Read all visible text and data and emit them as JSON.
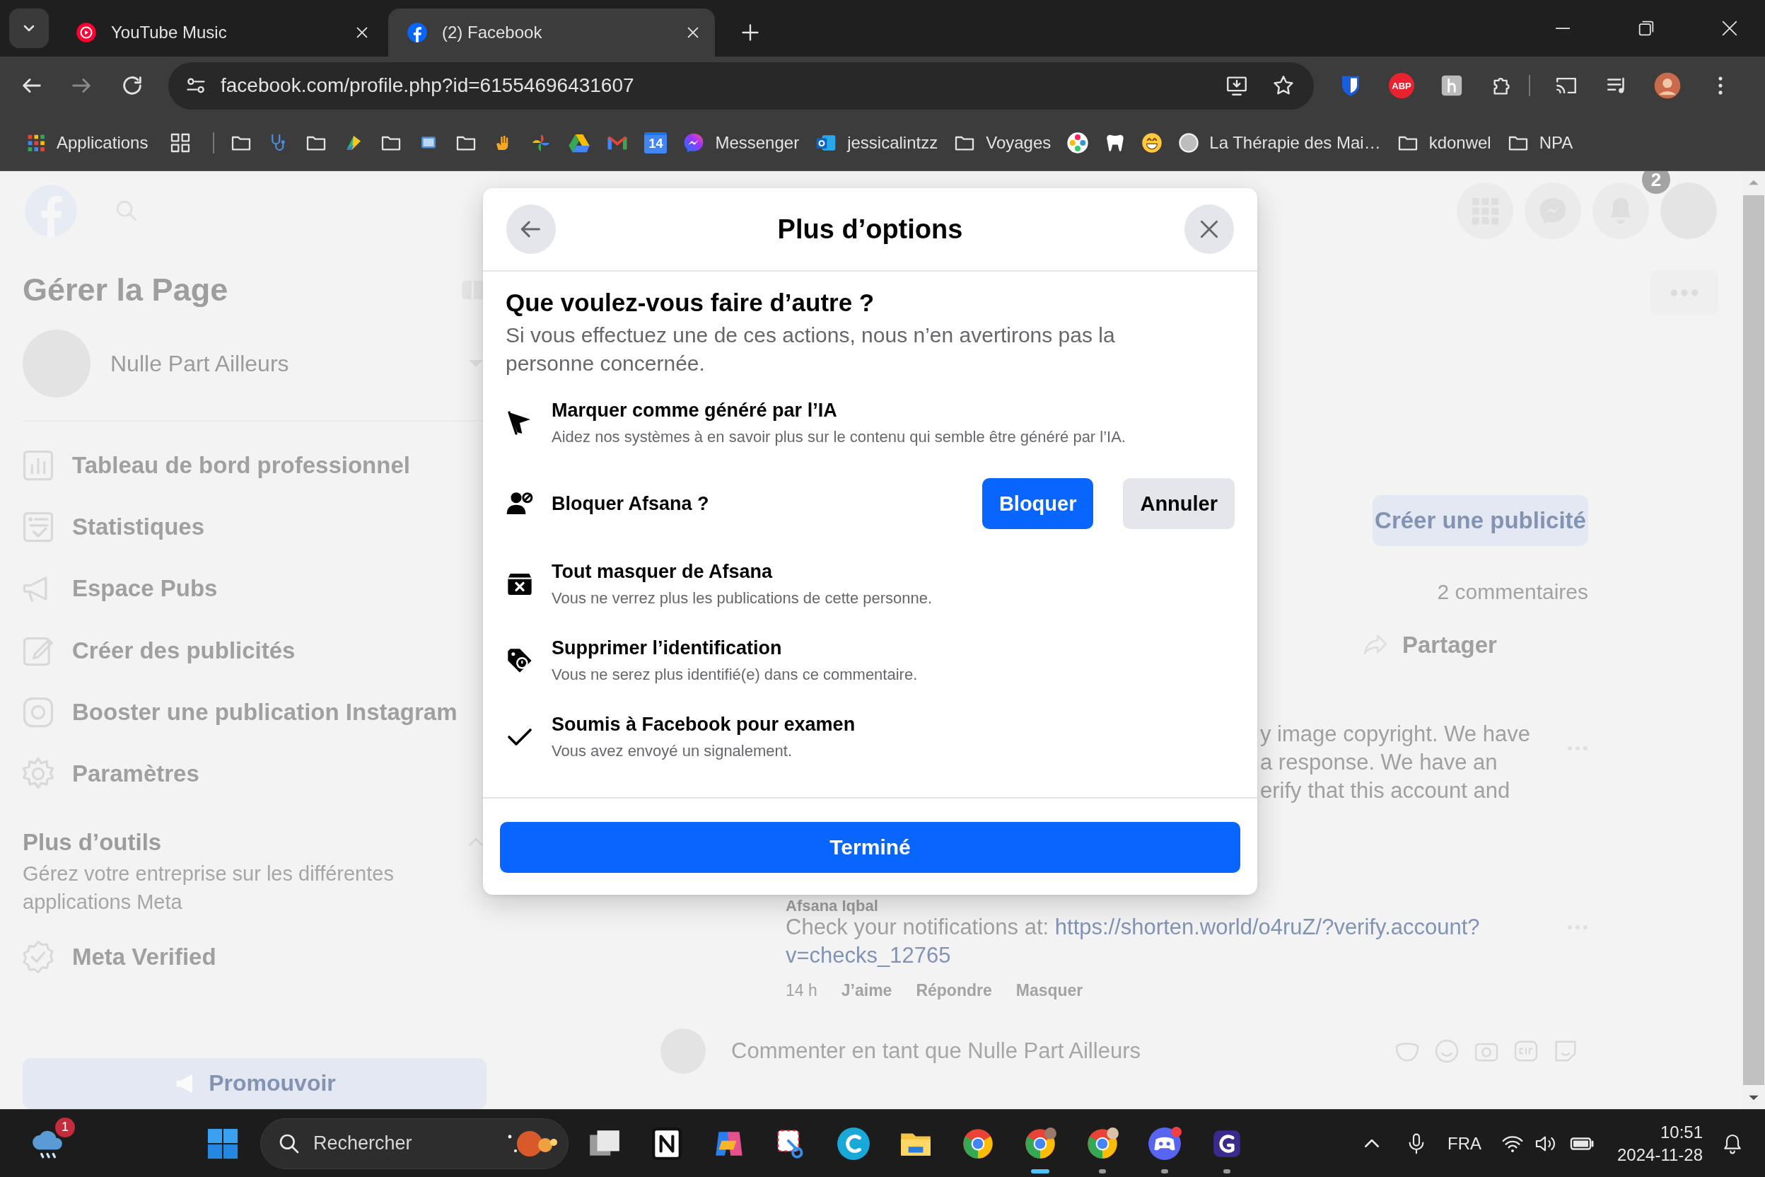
{
  "browser": {
    "tabs": [
      {
        "title": "YouTube Music",
        "selected": false
      },
      {
        "title": "(2) Facebook",
        "selected": true
      }
    ],
    "url": "facebook.com/profile.php?id=61554696431607",
    "extension_badge": "ABP",
    "bookmarks": [
      {
        "kind": "apps",
        "label": "Applications"
      },
      {
        "kind": "tab-groups"
      },
      {
        "kind": "separator"
      },
      {
        "kind": "folder"
      },
      {
        "kind": "site"
      },
      {
        "kind": "folder"
      },
      {
        "kind": "site"
      },
      {
        "kind": "folder"
      },
      {
        "kind": "site"
      },
      {
        "kind": "folder"
      },
      {
        "kind": "site"
      },
      {
        "kind": "site"
      },
      {
        "kind": "site"
      },
      {
        "kind": "site"
      },
      {
        "kind": "calendar",
        "label": "14"
      },
      {
        "kind": "site",
        "label": "Messenger"
      },
      {
        "kind": "site",
        "label": "jessicalintzz"
      },
      {
        "kind": "folder",
        "label": "Voyages"
      },
      {
        "kind": "site"
      },
      {
        "kind": "site"
      },
      {
        "kind": "site"
      },
      {
        "kind": "site",
        "label": "La Thérapie des Mai…"
      },
      {
        "kind": "folder",
        "label": "kdonwel"
      },
      {
        "kind": "folder",
        "label": "NPA"
      }
    ]
  },
  "page": {
    "sidebar": {
      "title": "Gérer la Page",
      "page_name": "Nulle Part Ailleurs",
      "menu": [
        "Tableau de bord professionnel",
        "Statistiques",
        "Espace Pubs",
        "Créer des publicités",
        "Booster une publication Instagram",
        "Paramètres"
      ],
      "more_tools": {
        "title": "Plus d’outils",
        "description": "Gérez votre entreprise sur les différentes applications Meta"
      },
      "meta_verified": "Meta Verified",
      "promote_button": "Promouvoir"
    },
    "notification_badge": "2",
    "feed": {
      "ad_button": "Créer une publicité",
      "comment_count": "2 commentaires",
      "share": "Partager",
      "comment_fragment": [
        "y image copyright. We have",
        "a response. We have an",
        "erify that this account and"
      ],
      "comment": {
        "author": "Afsana Iqbal",
        "text": "Check your notifications at:",
        "link_lines": [
          "https://shorten.world/o4ruZ/?verify.account?",
          "v=checks_12765"
        ],
        "time": "14 h",
        "actions": [
          "J’aime",
          "Répondre",
          "Masquer"
        ]
      },
      "composer": {
        "placeholder": "Commenter en tant que Nulle Part Ailleurs"
      }
    }
  },
  "dialog": {
    "title": "Plus d’options",
    "heading": "Que voulez-vous faire d’autre ?",
    "subtitle": "Si vous effectuez une de ces actions, nous n’en avertirons pas la personne concernée.",
    "options": [
      {
        "kind": "action",
        "title": "Marquer comme généré par l’IA",
        "description": "Aidez nos systèmes à en savoir plus sur le contenu qui semble être généré par l’IA."
      },
      {
        "kind": "confirm",
        "title": "Bloquer Afsana ?",
        "buttons": [
          {
            "label": "Bloquer",
            "primary": true
          },
          {
            "label": "Annuler",
            "primary": false
          }
        ]
      },
      {
        "kind": "action",
        "title": "Tout masquer de Afsana",
        "description": "Vous ne verrez plus les publications de cette personne."
      },
      {
        "kind": "action",
        "title": "Supprimer l’identification",
        "description": "Vous ne serez plus identifié(e) dans ce commentaire."
      },
      {
        "kind": "action",
        "title": "Soumis à Facebook pour examen",
        "description": "Vous avez envoyé un signalement."
      }
    ],
    "done_button": "Terminé"
  },
  "taskbar": {
    "weather_badge": "1",
    "search": {
      "placeholder": "Rechercher"
    },
    "apps": [
      {
        "open": false,
        "selected": false
      },
      {
        "open": false,
        "selected": false
      },
      {
        "open": false,
        "selected": false
      },
      {
        "open": false,
        "selected": false
      },
      {
        "open": false,
        "selected": false
      },
      {
        "open": false,
        "selected": false
      },
      {
        "open": false,
        "selected": false
      },
      {
        "open": true,
        "selected": true
      },
      {
        "open": true,
        "selected": false
      },
      {
        "open": true,
        "selected": false
      },
      {
        "open": true,
        "selected": false
      }
    ],
    "language": "FRA",
    "time": "10:51",
    "date": "2024-11-28"
  }
}
